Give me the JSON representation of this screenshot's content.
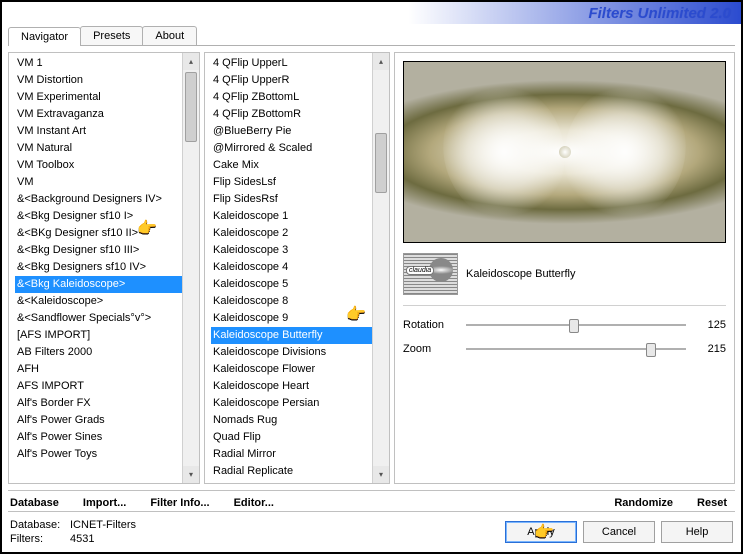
{
  "app": {
    "title": "Filters Unlimited 2.0"
  },
  "tabs": [
    "Navigator",
    "Presets",
    "About"
  ],
  "active_tab": 0,
  "category_list": [
    "VM 1",
    "VM Distortion",
    "VM Experimental",
    "VM Extravaganza",
    "VM Instant Art",
    "VM Natural",
    "VM Toolbox",
    "VM",
    "&<Background Designers IV>",
    "&<Bkg Designer sf10 I>",
    "&<BKg Designer sf10 II>",
    "&<Bkg Designer sf10 III>",
    "&<Bkg Designers sf10 IV>",
    "&<Bkg Kaleidoscope>",
    "&<Kaleidoscope>",
    "&<Sandflower Specials°v°>",
    "[AFS IMPORT]",
    "AB Filters 2000",
    "AFH",
    "AFS IMPORT",
    "Alf's Border FX",
    "Alf's Power Grads",
    "Alf's Power Sines",
    "Alf's Power Toys"
  ],
  "category_selected_index": 13,
  "filter_list": [
    "4 QFlip UpperL",
    "4 QFlip UpperR",
    "4 QFlip ZBottomL",
    "4 QFlip ZBottomR",
    "@BlueBerry Pie",
    "@Mirrored & Scaled",
    "Cake Mix",
    "Flip SidesLsf",
    "Flip SidesRsf",
    "Kaleidoscope 1",
    "Kaleidoscope 2",
    "Kaleidoscope 3",
    "Kaleidoscope 4",
    "Kaleidoscope 5",
    "Kaleidoscope 8",
    "Kaleidoscope 9",
    "Kaleidoscope Butterfly",
    "Kaleidoscope Divisions",
    "Kaleidoscope Flower",
    "Kaleidoscope Heart",
    "Kaleidoscope Persian",
    "Nomads Rug",
    "Quad Flip",
    "Radial Mirror",
    "Radial Replicate"
  ],
  "filter_selected_index": 16,
  "current_filter": {
    "name": "Kaleidoscope Butterfly"
  },
  "params": [
    {
      "label": "Rotation",
      "value": 125,
      "min": 0,
      "max": 255
    },
    {
      "label": "Zoom",
      "value": 215,
      "min": 0,
      "max": 255
    }
  ],
  "bottom_buttons": {
    "database": "Database",
    "import": "Import...",
    "filter_info": "Filter Info...",
    "editor": "Editor...",
    "randomize": "Randomize",
    "reset": "Reset"
  },
  "footer": {
    "database_label": "Database:",
    "database_value": "ICNET-Filters",
    "filters_label": "Filters:",
    "filters_value": "4531",
    "apply": "Apply",
    "cancel": "Cancel",
    "help": "Help"
  }
}
